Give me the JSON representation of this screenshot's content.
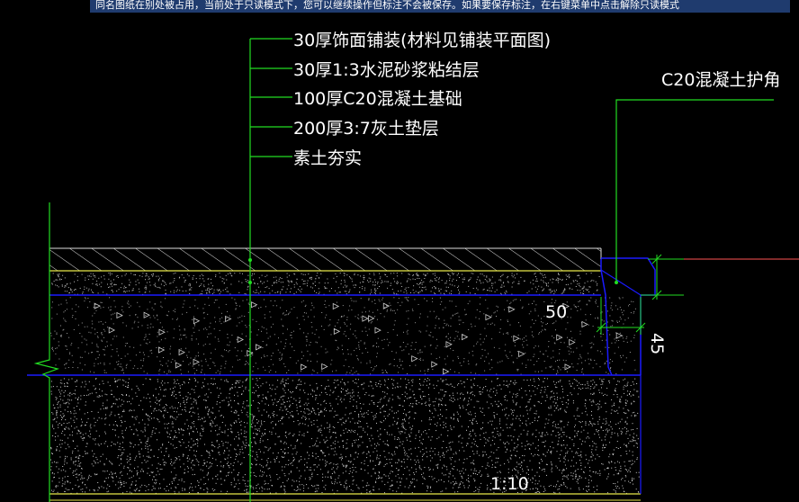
{
  "banner": {
    "message": "同名图纸在别处被占用，当前处于只读模式下，您可以继续操作但标注不会被保存。如果要保存标注，在右键菜单中点击解除只读模式"
  },
  "drawing": {
    "layer_labels": [
      "30厚饰面铺装(材料见铺装平面图)",
      "30厚1:3水泥砂浆粘结层",
      "100厚C20混凝土基础",
      "200厚3:7灰土垫层",
      "素土夯实"
    ],
    "corner_label": "C20混凝土护角",
    "dim_50": "50",
    "dim_45": "45",
    "slope_label": "1:10"
  },
  "colors": {
    "background": "#000000",
    "leader": "#22dd22",
    "base_line": "#1a1aff",
    "mortar_line": "#e8e84a",
    "text": "#ffffff",
    "hatch": "#dddddd",
    "ref_line": "#ff5555"
  }
}
